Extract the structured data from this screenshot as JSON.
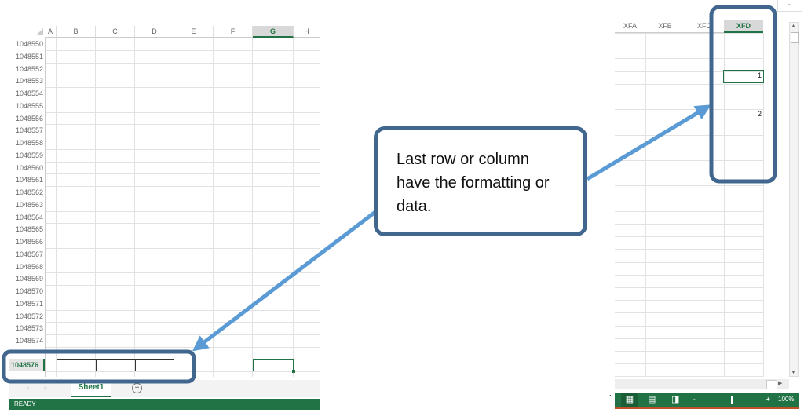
{
  "left_sheet": {
    "columns": [
      "A",
      "B",
      "C",
      "D",
      "E",
      "F",
      "G",
      "H"
    ],
    "selected_column": "G",
    "rows": [
      "1048550",
      "1048551",
      "1048552",
      "1048553",
      "1048554",
      "1048555",
      "1048556",
      "1048557",
      "1048558",
      "1048559",
      "1048560",
      "1048561",
      "1048562",
      "1048563",
      "1048564",
      "1048565",
      "1048566",
      "1048567",
      "1048568",
      "1048569",
      "1048570",
      "1048571",
      "1048572",
      "1048573",
      "1048574"
    ],
    "last_row": "1048576",
    "sheet_tab": "Sheet1",
    "add_sheet_icon": "plus-circle-icon",
    "status": "READY"
  },
  "right_sheet": {
    "columns": [
      "XFA",
      "XFB",
      "XFC",
      "XFD"
    ],
    "selected_column": "XFD",
    "values": [
      "1",
      "2"
    ],
    "zoom": "100%"
  },
  "callout": {
    "text": "Last row or column have the formatting or data."
  },
  "colors": {
    "excel_green": "#217346",
    "callout_border": "#41678f",
    "arrow": "#5b9bd5"
  }
}
